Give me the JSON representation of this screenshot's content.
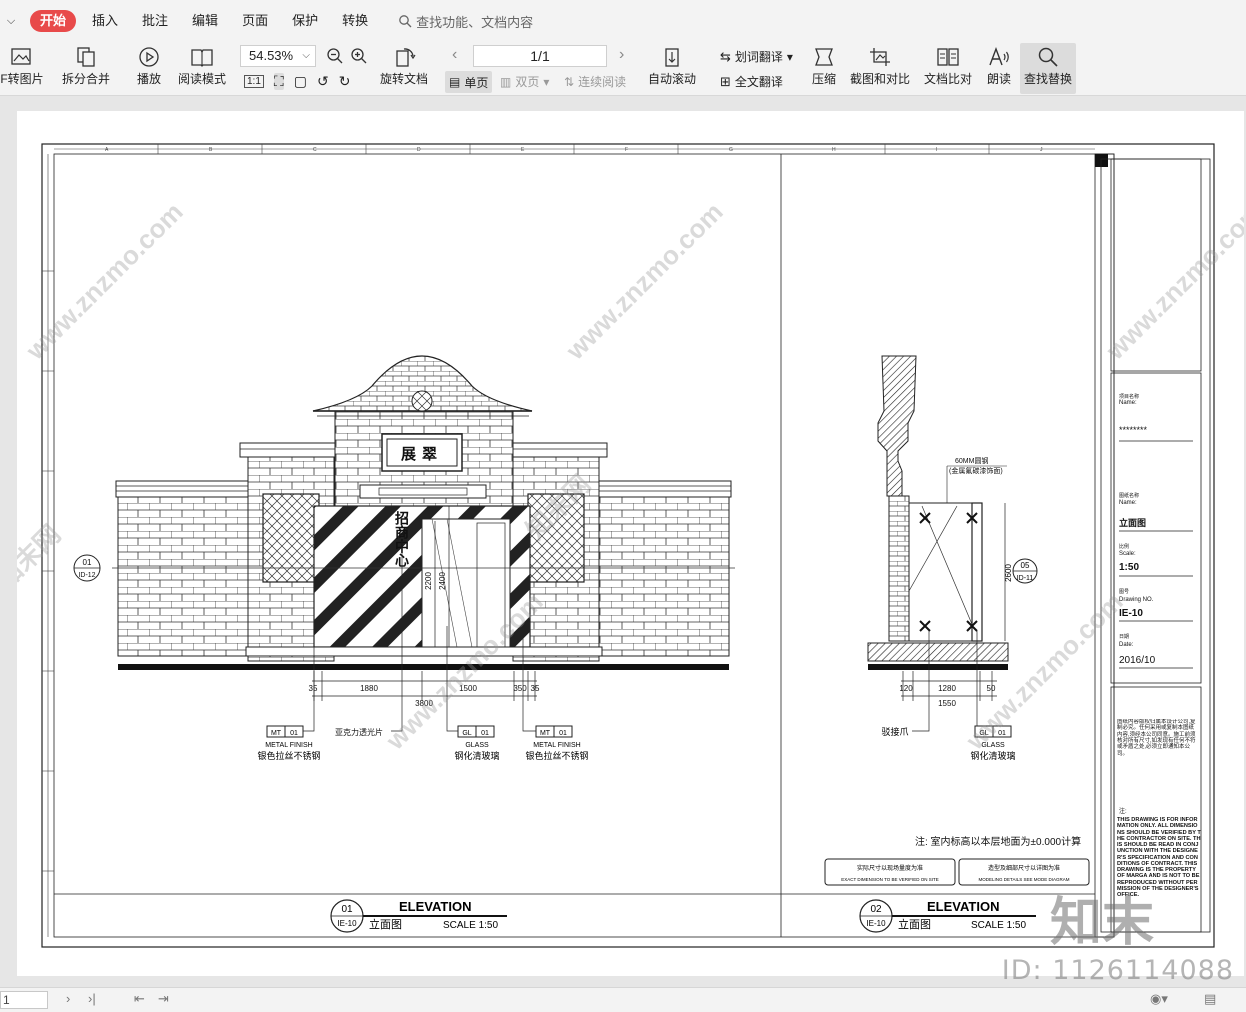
{
  "menubar": {
    "tabs": [
      "开始",
      "插入",
      "批注",
      "编辑",
      "页面",
      "保护",
      "转换"
    ],
    "search_placeholder": "查找功能、文档内容"
  },
  "ribbon": {
    "pdf_to_image": "F转图片",
    "split_merge": "拆分合并",
    "play": "播放",
    "read_mode": "阅读模式",
    "zoom_value": "54.53%",
    "rotate_doc": "旋转文档",
    "page_indicator": "1/1",
    "single_page": "单页",
    "double_page": "双页",
    "continuous": "连续阅读",
    "auto_scroll": "自动滚动",
    "word_translate": "划词翻译",
    "full_translate": "全文翻译",
    "compress": "压缩",
    "screenshot_compare": "截图和对比",
    "doc_compare": "文档比对",
    "read_aloud": "朗读",
    "find_replace": "查找替换",
    "one_to_one": "1:1"
  },
  "drawing": {
    "elevation_left": {
      "circle_num": "01",
      "circle_ref": "IE-10",
      "title": "ELEVATION",
      "subtitle": "立面图",
      "scale": "SCALE 1:50"
    },
    "elevation_right": {
      "circle_num": "02",
      "circle_ref": "IE-10",
      "title": "ELEVATION",
      "subtitle": "立面图",
      "scale": "SCALE 1:50"
    },
    "sign_text": "展翠",
    "door_text": "招商中心",
    "side_ref_left": {
      "num": "01",
      "ref": "ID-12"
    },
    "side_ref_right": {
      "num": "05",
      "ref": "ID-11"
    },
    "dims_left": [
      "35",
      "1880",
      "1500",
      "350",
      "35",
      "3800"
    ],
    "dims_vertical_left": [
      "2200",
      "2400"
    ],
    "dims_right": [
      "120",
      "1280",
      "50",
      "1550"
    ],
    "dims_vertical_right": [
      "2600"
    ],
    "tags_left": [
      {
        "code": "MT",
        "num": "01",
        "en": "METAL FINISH",
        "cn": "银色拉丝不锈钢"
      },
      {
        "code": "GL",
        "num": "01",
        "en": "GLASS",
        "cn": "钢化清玻璃"
      },
      {
        "code": "MT",
        "num": "01",
        "en": "METAL FINISH",
        "cn": "银色拉丝不锈钢"
      }
    ],
    "acrylic_label": "亚克力透光片",
    "tag_right": {
      "code": "GL",
      "num": "01",
      "en": "GLASS",
      "cn": "钢化清玻璃"
    },
    "clamp_label": "驳接爪",
    "pipe_label_1": "60MM圆钢",
    "pipe_label_2": "(金属氟碳漆饰面)",
    "note_main": "注: 室内标高以本层地面为±0.000计算",
    "note_box1_cn": "实际尺寸以现场量度为准",
    "note_box1_en": "EXACT DIMENSION TO BE VERIFIED ON SITE",
    "note_box2_cn": "造型及细部尺寸以详图为准",
    "note_box2_en": "MODELING DETAILS SEE MODE DIAGRAM",
    "grid_top_left": [
      "A",
      "B",
      "C",
      "D",
      "E",
      "F",
      "G"
    ],
    "grid_top_right": [
      "H",
      "I",
      "J"
    ],
    "title_block": {
      "project_label_cn": "项目名称",
      "project_label_en": "Name:",
      "project_value": "********",
      "drawing_label_cn": "图纸名称",
      "drawing_label_en": "Name:",
      "drawing_value": "立面图",
      "scale_label_cn": "比例",
      "scale_label_en": "Scale:",
      "scale_value": "1:50",
      "no_label_cn": "图号",
      "no_label_en": "Drawing NO.",
      "no_value": "IE-10",
      "date_label_cn": "日期",
      "date_label_en": "Date:",
      "date_value": "2016/10",
      "notes_cn": "图纸内容版权归属本设计公司,复制必究。任何采用或复制本图纸内容,须经本公司同意。施工前须核对所有尺寸,如发现有任何不符或矛盾之处,必须立即通知本公司。",
      "notes_label": "注:",
      "notes_en": "THIS DRAWING IS FOR INFORMATION ONLY. ALL DIMENSIONS SHOULD BE VERIFIED BY THE CONTRACTOR ON SITE. THIS SHOULD BE READ IN CONJUNCTION WITH THE DESIGNER'S SPECIFICATION AND CONDITIONS OF CONTRACT. THIS DRAWING IS THE PROPERTY OF MARGA AND IS NOT TO BE REPRODUCED WITHOUT PERMISSION OF THE DESIGNER'S OFFICE."
    }
  },
  "watermark": {
    "site": "www.znzmo.com",
    "brand": "知末网",
    "logo": "知末",
    "id_text": "ID: 1126114088"
  },
  "status": {
    "page_input": "1"
  }
}
